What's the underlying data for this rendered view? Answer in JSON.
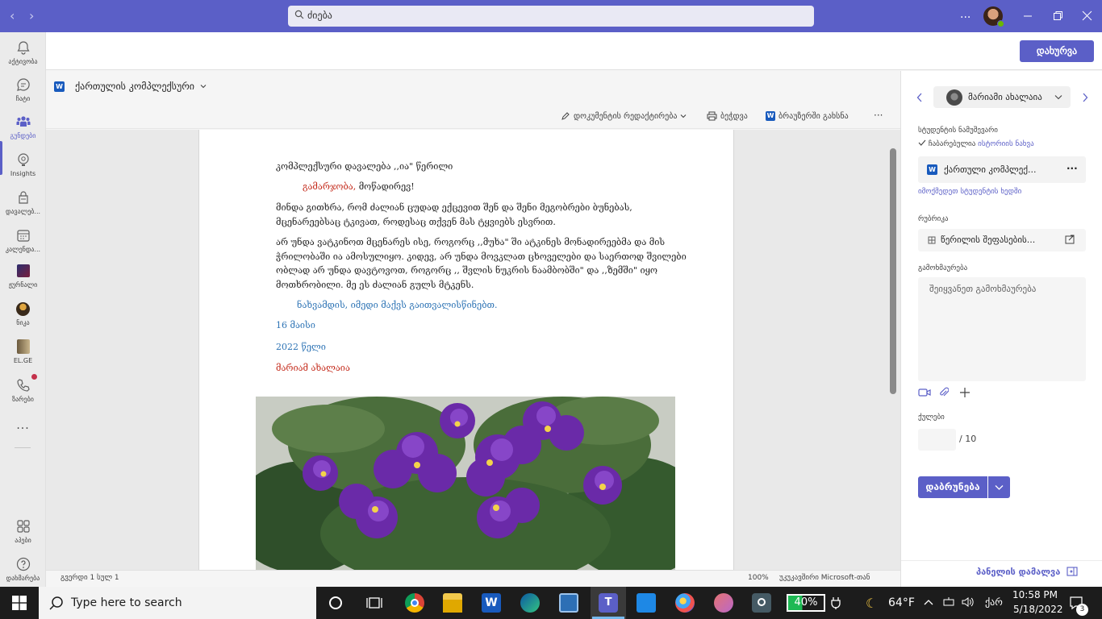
{
  "titlebar": {
    "search_value": "ძიება",
    "more": "...",
    "nav_back": "‹",
    "nav_forward": "›"
  },
  "rail": {
    "items": [
      {
        "label": "აქტივობა",
        "icon": "bell-icon"
      },
      {
        "label": "ჩატი",
        "icon": "chat-icon"
      },
      {
        "label": "გუნდები",
        "icon": "teams-icon"
      },
      {
        "label": "Insights",
        "icon": "insights-icon"
      },
      {
        "label": "დავალებ...",
        "icon": "assignments-icon"
      },
      {
        "label": "კალენდა...",
        "icon": "calendar-icon"
      },
      {
        "label": "ჟურნალი",
        "icon": "journal-icon"
      },
      {
        "label": "ნიკა",
        "icon": "nika-app-icon"
      },
      {
        "label": "EL.GE",
        "icon": "elge-app-icon"
      },
      {
        "label": "ზარები",
        "icon": "phone-icon"
      },
      {
        "label": "...",
        "icon": "more-icon"
      },
      {
        "label": "აპები",
        "icon": "apps-icon"
      },
      {
        "label": "დახმარება",
        "icon": "help-icon"
      }
    ]
  },
  "appbar": {
    "close_label": "დახურვა"
  },
  "doc": {
    "title": "ქართულის კომპლექსური",
    "tools": {
      "edit": "დოკუმენტის რედაქტირება",
      "print": "ბეჭდვა",
      "open_browser": "ბრაუზერში გახსნა",
      "more": "···"
    },
    "lines": {
      "heading": "კომპლექსური დავალება ,,ია\" წერილი",
      "greet_red": "გამარჯობა,",
      "greet_rest": " მოწადირევ!",
      "p1": "მინდა გითხრა, რომ ძალიან ცუდად ექცევით შენ და შენი მეგობრები ბუნებას, მცენარეებსაც ტკივათ, როდესაც თქვენ მას ტყვიებს ესვრით.",
      "p2": "არ უნდა ვატკინოთ მცენარეს ისე,  როგორც ,,მუხა\" ში ატკინეს მონადირეებმა და მის ჭრილობაში ია ამოსულიყო. კიდევ, არ უნდა მოვკლათ ცხოველები და საერთოდ შვილები ობლად არ უნდა დავტოვოთ, როგორც ,, შვლის ნუკრის ნაამბობში\" და ,,ზემში\" იყო მოთხრობილი. მე ეს ძალიან გულს მტკენს.",
      "closing": "ნახვამდის, იმედი მაქვს გაითვალისწინებთ.",
      "date1": "16 მაისი",
      "date2": "2022 წელი",
      "sign": "მარიამ ახალაია"
    },
    "status_left": "გვერდი 1 სულ 1",
    "zoom": "100%",
    "status_right": "უკუკავშირი Microsoft-თან"
  },
  "panel": {
    "student_name": "მარიამი ახალაია",
    "work_label": "სტუდენტის ნამუშევარი",
    "submitted": "ჩაბარებულია",
    "history_link": "ისტორიის ნახვა",
    "file_name": "ქართული კომპლექ...",
    "file_more": "···",
    "view_as_student": "იმოქმედეთ სტუდენტის ხედში",
    "rubric_label": "რუბრიკა",
    "rubric_name": "წერილის შეფასების...",
    "feedback_label": "გამოხმაურება",
    "feedback_placeholder": "შეიყვანეთ გამოხმაურება",
    "points_label": "ქულები",
    "points_value": "",
    "points_total": "/ 10",
    "return_label": "დაბრუნება",
    "hide_panel": "პანელის დამალვა"
  },
  "taskbar": {
    "search_placeholder": "Type here to search",
    "battery": "40%",
    "weather": "64°F",
    "lang": "ქარ",
    "time": "10:58 PM",
    "date": "5/18/2022",
    "notifications": "3"
  },
  "colors": {
    "accent": "#5b5fc7",
    "red_text": "#c42b1c",
    "blue_text": "#2e74b5",
    "taskbar": "#1c1c1c"
  }
}
